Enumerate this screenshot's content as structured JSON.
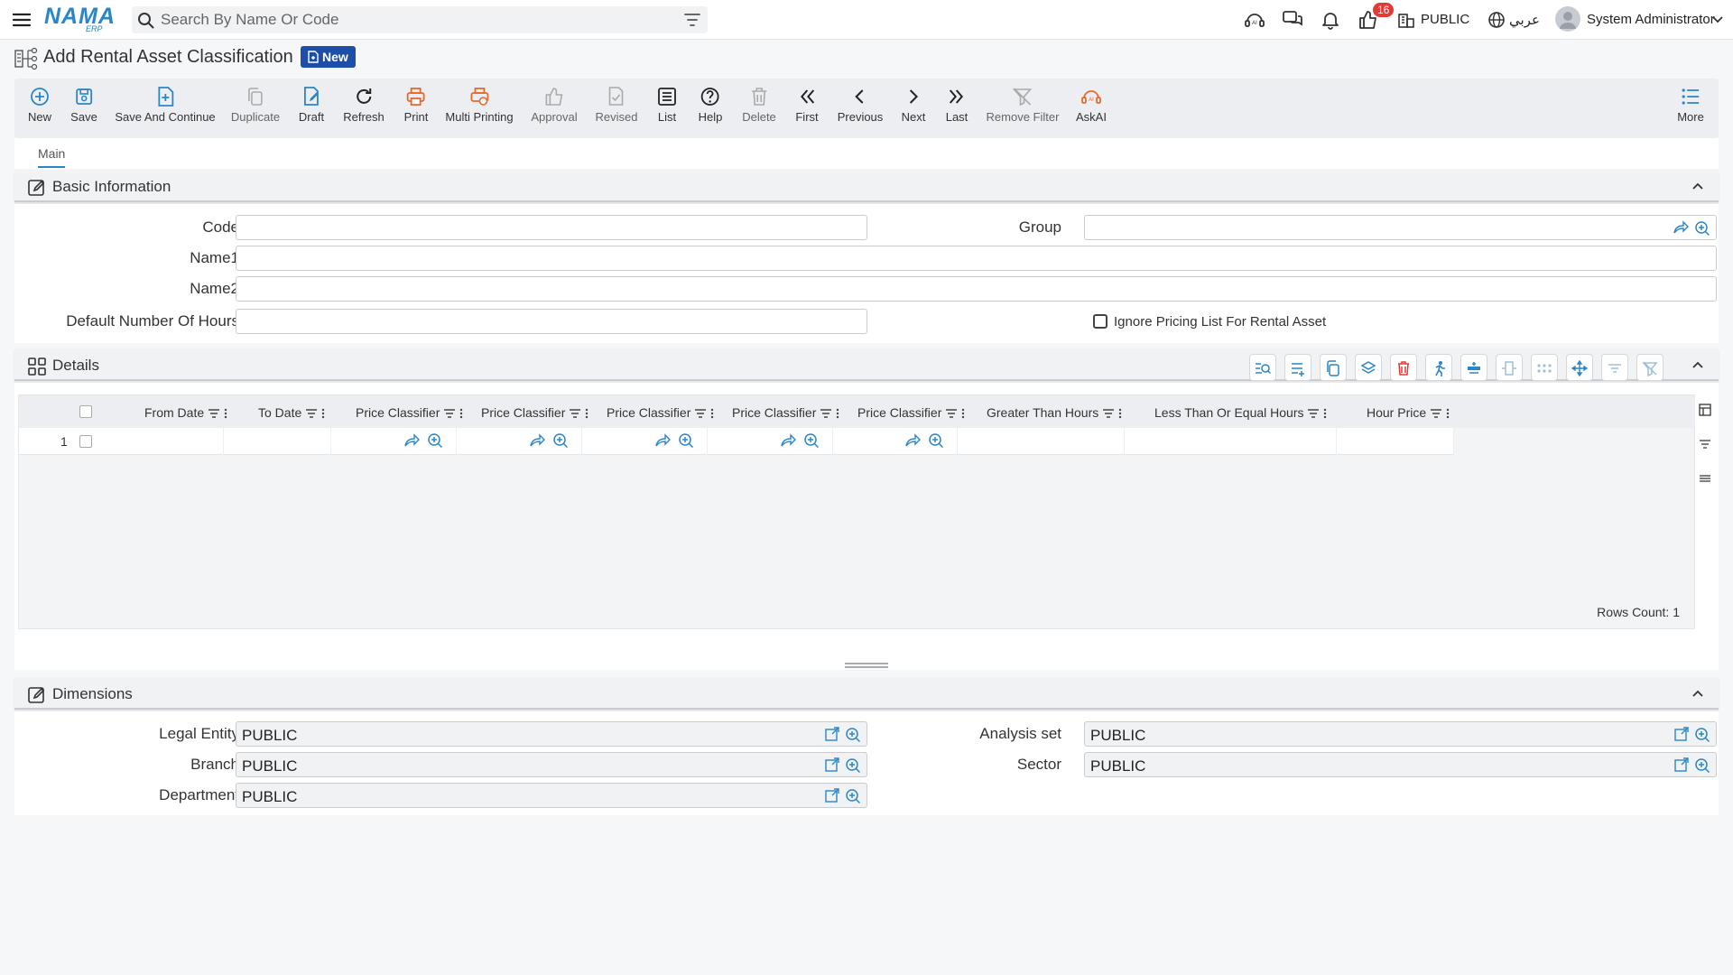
{
  "topbar": {
    "logo_text": "NAMA",
    "logo_sub": "ERP",
    "search_placeholder": "Search By Name Or Code",
    "notification_count": "16",
    "entity_label": "PUBLIC",
    "language_label": "عربي",
    "user_name": "System Administrator"
  },
  "page": {
    "title": "Add Rental Asset Classification",
    "status_badge": "New"
  },
  "toolbar": [
    {
      "label": "New",
      "icon": "plus-circle-icon",
      "color": "#2a86c9"
    },
    {
      "label": "Save",
      "icon": "save-icon",
      "color": "#2a86c9"
    },
    {
      "label": "Save And Continue",
      "icon": "save-continue-icon",
      "color": "#2a86c9"
    },
    {
      "label": "Duplicate",
      "icon": "duplicate-icon",
      "color": "#aaaaaa"
    },
    {
      "label": "Draft",
      "icon": "draft-icon",
      "color": "#2a86c9"
    },
    {
      "label": "Refresh",
      "icon": "refresh-icon",
      "color": "#222222"
    },
    {
      "label": "Print",
      "icon": "print-icon",
      "color": "#e8692c"
    },
    {
      "label": "Multi Printing",
      "icon": "multi-print-icon",
      "color": "#e8692c"
    },
    {
      "label": "Approval",
      "icon": "thumbs-up-icon",
      "color": "#aaaaaa"
    },
    {
      "label": "Revised",
      "icon": "revised-icon",
      "color": "#aaaaaa"
    },
    {
      "label": "List",
      "icon": "list-icon",
      "color": "#222222"
    },
    {
      "label": "Help",
      "icon": "help-icon",
      "color": "#222222"
    },
    {
      "label": "Delete",
      "icon": "trash-icon",
      "color": "#aaaaaa"
    },
    {
      "label": "First",
      "icon": "first-icon",
      "color": "#222222"
    },
    {
      "label": "Previous",
      "icon": "previous-icon",
      "color": "#222222"
    },
    {
      "label": "Next",
      "icon": "next-icon",
      "color": "#222222"
    },
    {
      "label": "Last",
      "icon": "last-icon",
      "color": "#222222"
    },
    {
      "label": "Remove Filter",
      "icon": "remove-filter-icon",
      "color": "#aaaaaa"
    },
    {
      "label": "AskAI",
      "icon": "ask-ai-icon",
      "color": "#e8692c"
    },
    {
      "label": "More",
      "icon": "more-icon",
      "color": "#2a86c9"
    }
  ],
  "tabs": {
    "main": "Main"
  },
  "basic": {
    "title": "Basic Information",
    "code_label": "Code",
    "group_label": "Group",
    "name1_label": "Name1",
    "name2_label": "Name2",
    "hours_label": "Default Number Of Hours",
    "ignore_label": "Ignore Pricing List For Rental Asset"
  },
  "details": {
    "title": "Details",
    "columns": [
      "From Date",
      "To Date",
      "Price Classifier",
      "Price Classifier",
      "Price Classifier",
      "Price Classifier",
      "Price Classifier",
      "Greater Than Hours",
      "Less Than Or Equal Hours",
      "Hour Price"
    ],
    "row_number": "1",
    "rows_count": "Rows Count: 1"
  },
  "dimensions": {
    "title": "Dimensions",
    "legal_entity_label": "Legal Entity",
    "legal_entity_value": "PUBLIC",
    "branch_label": "Branch",
    "branch_value": "PUBLIC",
    "department_label": "Department",
    "department_value": "PUBLIC",
    "analysis_label": "Analysis set",
    "analysis_value": "PUBLIC",
    "sector_label": "Sector",
    "sector_value": "PUBLIC"
  }
}
